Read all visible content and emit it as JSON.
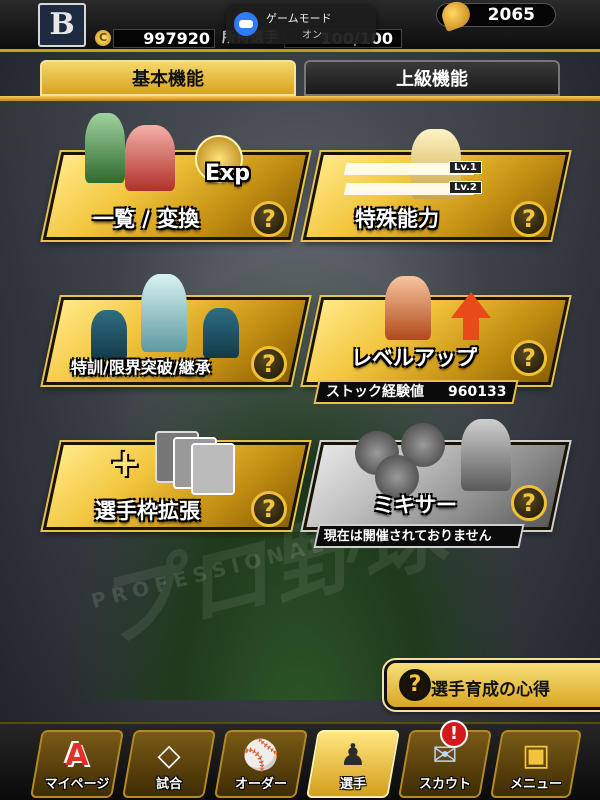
{
  "header": {
    "team_logo": "B",
    "coin_icon": "coin-icon",
    "coins": "997920",
    "owned_label": "所持選手",
    "owned_count": "100/100",
    "gem_icon": "gem-icon",
    "gems": "2065"
  },
  "toast": {
    "title": "ゲームモード",
    "subtitle": "オン"
  },
  "tabs": {
    "basic": "基本機能",
    "advanced": "上級機能"
  },
  "cards": {
    "list_convert": {
      "label": "一覧 / 変換",
      "badge_text": "Exp"
    },
    "special_ability": {
      "label": "特殊能力",
      "lv1": "Lv.1",
      "lv2": "Lv.2"
    },
    "training": {
      "label": "特訓/限界突破/継承"
    },
    "level_up": {
      "label": "レベルアップ",
      "stock_label": "ストック経験値",
      "stock_value": "960133"
    },
    "expand_slots": {
      "label": "選手枠拡張"
    },
    "mixer": {
      "label": "ミキサー",
      "status": "現在は開催されておりません"
    }
  },
  "help_symbol": "?",
  "tips": {
    "label": "選手育成の心得"
  },
  "bottom_nav": [
    {
      "label": "マイページ",
      "glyph": "A"
    },
    {
      "label": "試合",
      "glyph": "◇"
    },
    {
      "label": "オーダー",
      "glyph": "⚾"
    },
    {
      "label": "選手",
      "glyph": "♟"
    },
    {
      "label": "スカウト",
      "glyph": "✉"
    },
    {
      "label": "メニュー",
      "glyph": "▣"
    }
  ],
  "notification_badge": "!",
  "colors": {
    "gold": "#f2c53d",
    "gold_dark": "#8a5f05",
    "badge_red": "#d21a1a",
    "toast_blue": "#2f7cf6"
  }
}
